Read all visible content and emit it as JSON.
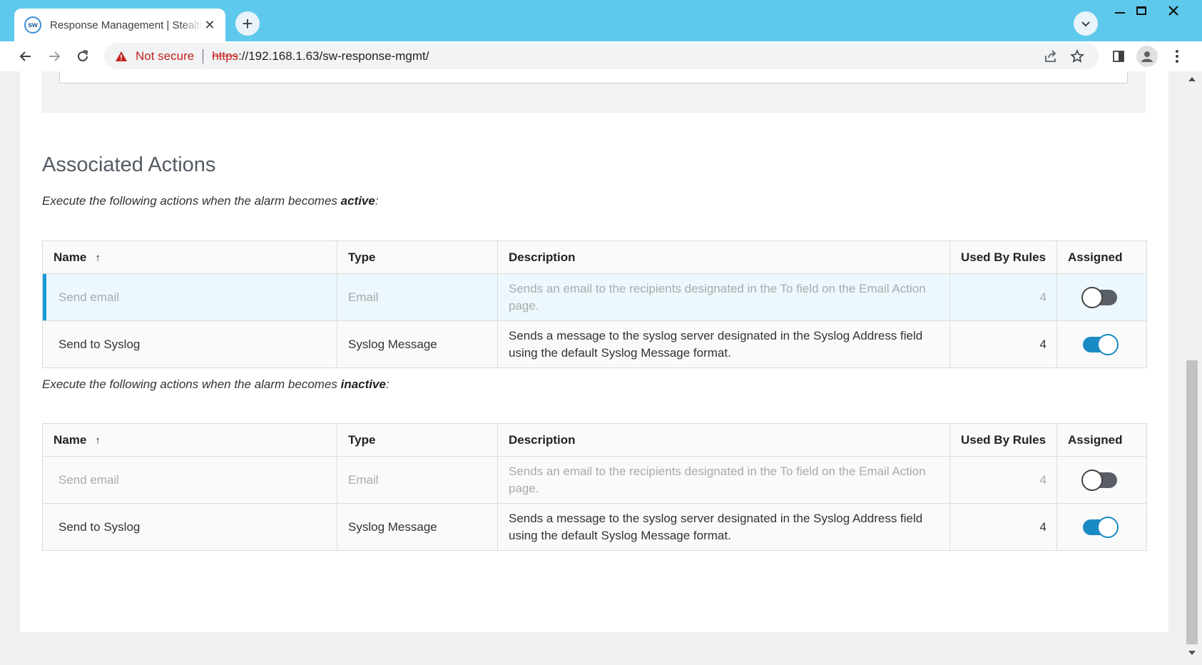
{
  "browser": {
    "tab_title": "Response Management | Stealthwatch",
    "favicon_text": "sw",
    "security_label": "Not secure",
    "url_scheme": "https",
    "url_rest": "://192.168.1.63/sw-response-mgmt/"
  },
  "page": {
    "section_title": "Associated Actions",
    "active_intro_prefix": "Execute the following actions when the alarm becomes ",
    "active_intro_keyword": "active",
    "inactive_intro_prefix": "Execute the following actions when the alarm becomes ",
    "inactive_intro_keyword": "inactive",
    "intro_suffix": ":",
    "columns": {
      "name": "Name",
      "type": "Type",
      "description": "Description",
      "used_by_rules": "Used By Rules",
      "assigned": "Assigned"
    },
    "active_rows": [
      {
        "name": "Send email",
        "type": "Email",
        "description": "Sends an email to the recipients designated in the To field on the Email Action page.",
        "used_by_rules": "4",
        "assigned": false
      },
      {
        "name": "Send to Syslog",
        "type": "Syslog Message",
        "description": "Sends a message to the syslog server designated in the Syslog Address field using the default Syslog Message format.",
        "used_by_rules": "4",
        "assigned": true
      }
    ],
    "inactive_rows": [
      {
        "name": "Send email",
        "type": "Email",
        "description": "Sends an email to the recipients designated in the To field on the Email Action page.",
        "used_by_rules": "4",
        "assigned": false
      },
      {
        "name": "Send to Syslog",
        "type": "Syslog Message",
        "description": "Sends a message to the syslog server designated in the Syslog Address field using the default Syslog Message format.",
        "used_by_rules": "4",
        "assigned": true
      }
    ]
  },
  "colors": {
    "accent": "#1a8ac4",
    "selected_row_bg": "#ecf8fd",
    "not_secure": "#c5221f",
    "tab_strip": "#5ec9ec"
  },
  "icons": [
    "warning-icon",
    "back-icon",
    "forward-icon",
    "reload-icon",
    "share-icon",
    "star-icon",
    "side-panel-icon",
    "profile-icon",
    "menu-icon",
    "sort-ascending-icon"
  ]
}
